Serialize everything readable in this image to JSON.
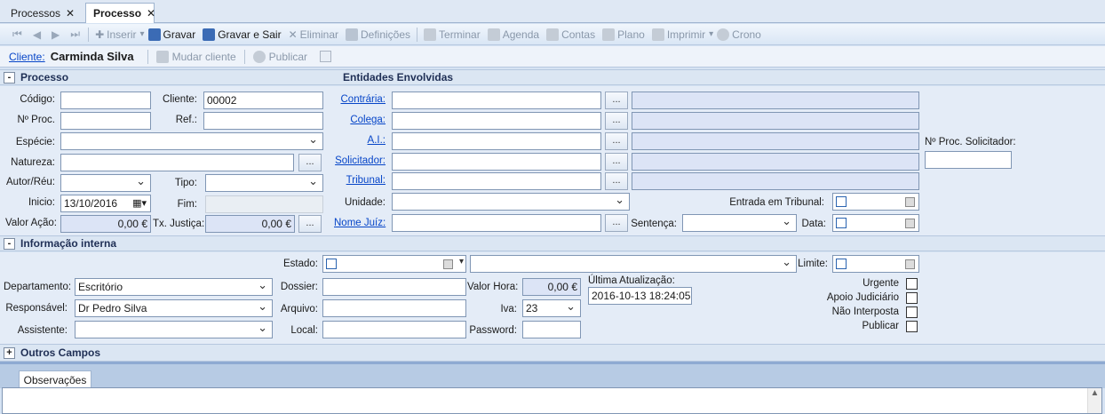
{
  "tabs": [
    {
      "label": "Processos",
      "active": false
    },
    {
      "label": "Processo",
      "active": true
    }
  ],
  "toolbar": {
    "inserir": "Inserir",
    "gravar": "Gravar",
    "gravar_sair": "Gravar e Sair",
    "eliminar": "Eliminar",
    "definicoes": "Definições",
    "terminar": "Terminar",
    "agenda": "Agenda",
    "contas": "Contas",
    "plano": "Plano",
    "imprimir": "Imprimir",
    "crono": "Crono"
  },
  "clientbar": {
    "label": "Cliente:",
    "name": "Carminda Silva",
    "mudar": "Mudar cliente",
    "publicar": "Publicar"
  },
  "processo": {
    "header": "Processo",
    "codigo_label": "Código:",
    "codigo": "",
    "cliente_label": "Cliente:",
    "cliente": "00002",
    "nproc_label": "Nº Proc.",
    "ref_label": "Ref.:",
    "especie_label": "Espécie:",
    "natureza_label": "Natureza:",
    "autor_label": "Autor/Réu:",
    "tipo_label": "Tipo:",
    "inicio_label": "Inicio:",
    "inicio": "13/10/2016",
    "fim_label": "Fim:",
    "valor_acao_label": "Valor Ação:",
    "valor_acao": "0,00 €",
    "tx_justica_label": "Tx. Justiça:",
    "tx_justica": "0,00 €"
  },
  "entidades": {
    "header": "Entidades Envolvidas",
    "contraria": "Contrária:",
    "colega": "Colega:",
    "ai": "A.I.:",
    "solicitador": "Solicitador:",
    "tribunal": "Tribunal:",
    "unidade": "Unidade:",
    "nome_juiz": "Nome Juíz:",
    "sentenca": "Sentença:",
    "nproc_solicitador": "Nº Proc. Solicitador:",
    "entrada_tribunal": "Entrada em Tribunal:",
    "data": "Data:"
  },
  "interna": {
    "header": "Informação interna",
    "estado_label": "Estado:",
    "limite_label": "Limite:",
    "departamento_label": "Departamento:",
    "departamento": "Escritório",
    "responsavel_label": "Responsável:",
    "responsavel": "Dr Pedro Silva",
    "assistente_label": "Assistente:",
    "dossier_label": "Dossier:",
    "arquivo_label": "Arquivo:",
    "local_label": "Local:",
    "valor_hora_label": "Valor Hora:",
    "valor_hora": "0,00 €",
    "iva_label": "Iva:",
    "iva": "23",
    "password_label": "Password:",
    "ultima_label": "Última Atualização:",
    "ultima": "2016-10-13 18:24:05",
    "urgente": "Urgente",
    "apoio": "Apoio Judiciário",
    "nao_interposta": "Não Interposta",
    "publicar": "Publicar"
  },
  "outros": {
    "header": "Outros Campos"
  },
  "observacoes": {
    "tab": "Observações"
  },
  "colors": {
    "link": "#0645c8",
    "header_text": "#1f2f55",
    "ro_field": "#dce4f6"
  }
}
